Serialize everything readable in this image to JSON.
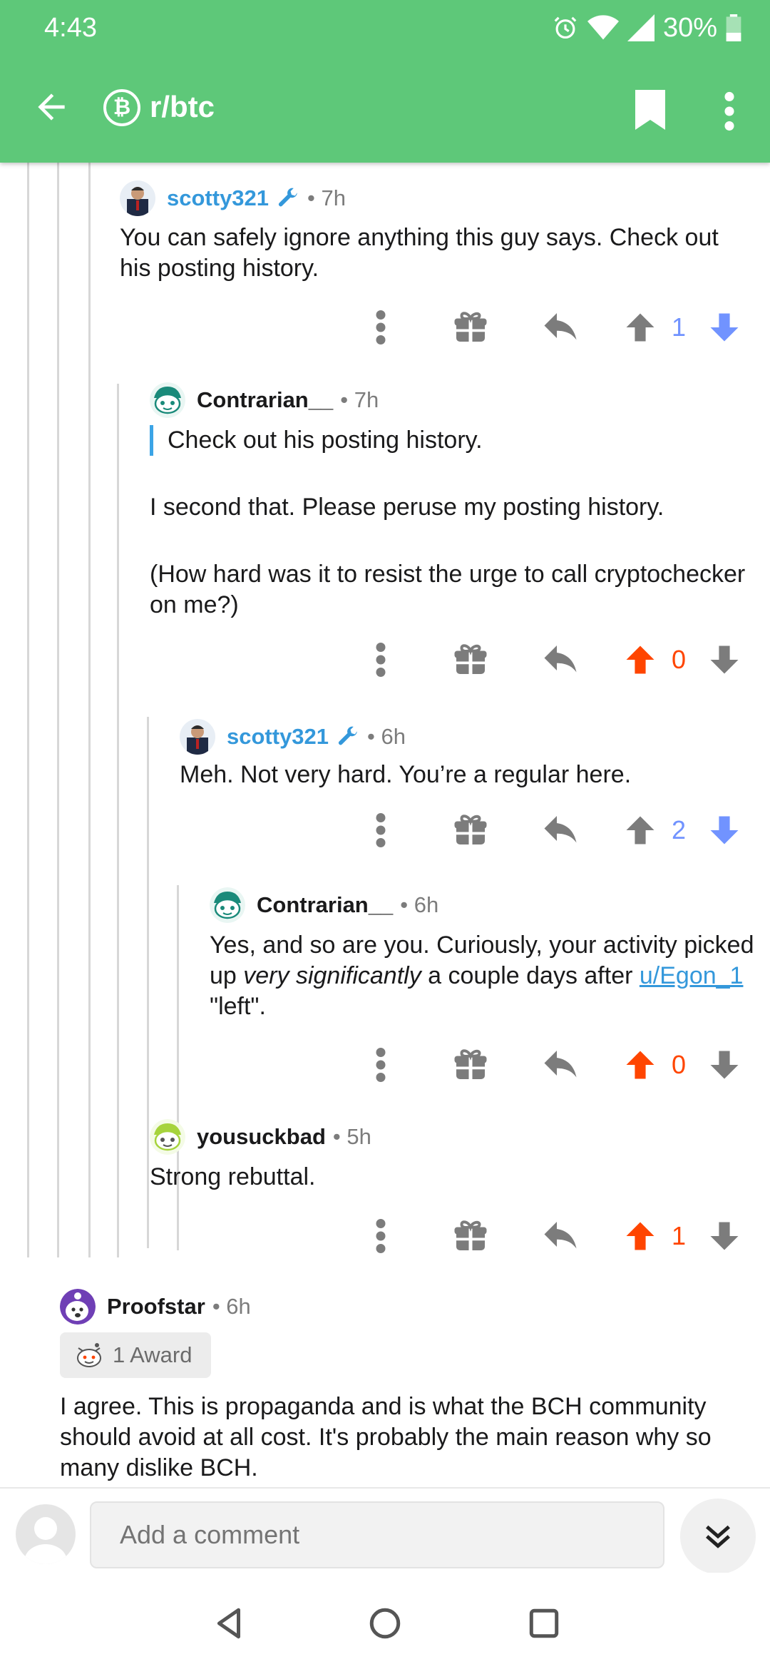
{
  "status_bar": {
    "time": "4:43",
    "battery": "30%"
  },
  "toolbar": {
    "subreddit": "r/btc"
  },
  "comments": [
    {
      "author": "scotty321",
      "time": "• 7h",
      "body": "You can safely ignore anything this guy says. Check out his posting history.",
      "score": "1",
      "vote": "down"
    },
    {
      "author": "Contrarian__",
      "time": "• 7h",
      "quote": "Check out his posting history.",
      "para1": "I second that. Please peruse my posting history.",
      "para2": "(How hard was it to resist the urge to call cryptochecker on me?)",
      "score": "0",
      "vote": "up"
    },
    {
      "author": "scotty321",
      "time": "• 6h",
      "body": "Meh. Not very hard. You’re a regular here.",
      "score": "2",
      "vote": "down"
    },
    {
      "author": "Contrarian__",
      "time": "• 6h",
      "body_pre": "Yes, and so are you. Curiously, your activity picked up ",
      "body_em": "very significantly",
      "body_mid": " a couple days after ",
      "body_link": "u/Egon_1",
      "body_post": " \"left\".",
      "score": "0",
      "vote": "up"
    },
    {
      "author": "yousuckbad",
      "time": "• 5h",
      "body": "Strong rebuttal.",
      "score": "1",
      "vote": "up"
    },
    {
      "author": "Proofstar",
      "time": "• 6h",
      "award": "1 Award",
      "body": "I agree. This is propaganda and is what the BCH community should avoid at all cost. It's probably the main reason why so many dislike BCH."
    }
  ],
  "composer": {
    "placeholder": "Add a comment"
  },
  "colors": {
    "accent_green": "#5ec879",
    "upvote": "#ff4500",
    "downvote": "#7193ff",
    "link": "#3498db"
  }
}
